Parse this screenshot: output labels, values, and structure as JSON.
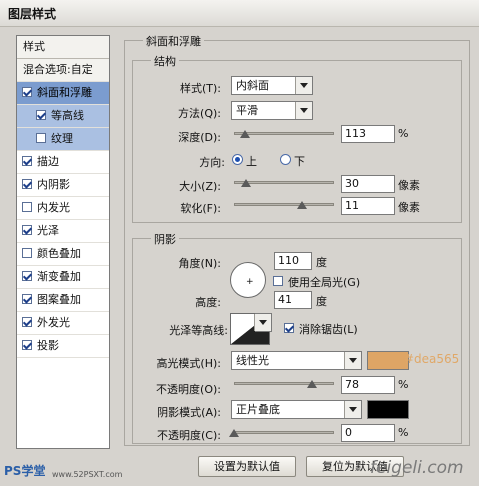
{
  "window": {
    "title": "图层样式"
  },
  "sidebar": {
    "header": "样式",
    "blending": "混合选项:自定",
    "items": [
      {
        "label": "斜面和浮雕",
        "checked": true
      },
      {
        "label": "等高线",
        "checked": true
      },
      {
        "label": "纹理",
        "checked": false
      },
      {
        "label": "描边",
        "checked": true
      },
      {
        "label": "内阴影",
        "checked": true
      },
      {
        "label": "内发光",
        "checked": false
      },
      {
        "label": "光泽",
        "checked": true
      },
      {
        "label": "颜色叠加",
        "checked": false
      },
      {
        "label": "渐变叠加",
        "checked": true
      },
      {
        "label": "图案叠加",
        "checked": true
      },
      {
        "label": "外发光",
        "checked": true
      },
      {
        "label": "投影",
        "checked": true
      }
    ]
  },
  "bevel": {
    "section_title": "斜面和浮雕",
    "structure": {
      "title": "结构",
      "style_label": "样式(T):",
      "style_value": "内斜面",
      "technique_label": "方法(Q):",
      "technique_value": "平滑",
      "depth_label": "深度(D):",
      "depth_value": "113",
      "depth_unit": "%",
      "depth_fraction": 0.11,
      "direction_label": "方向:",
      "direction_up": "上",
      "direction_down": "下",
      "size_label": "大小(Z):",
      "size_value": "30",
      "size_unit": "像素",
      "size_fraction": 0.12,
      "soften_label": "软化(F):",
      "soften_value": "11",
      "soften_unit": "像素",
      "soften_fraction": 0.68
    },
    "shading": {
      "title": "阴影",
      "angle_label": "角度(N):",
      "angle_value": "110",
      "angle_unit": "度",
      "global_light_label": "使用全局光(G)",
      "global_light_checked": false,
      "altitude_label": "高度:",
      "altitude_value": "41",
      "altitude_unit": "度",
      "gloss_label": "光泽等高线:",
      "antialias_label": "消除锯齿(L)",
      "antialias_checked": true,
      "highlight_mode_label": "高光模式(H):",
      "highlight_mode_value": "线性光",
      "highlight_color": "#dea565",
      "highlight_color_text": "#dea565",
      "highlight_opacity_label": "不透明度(O):",
      "highlight_opacity_value": "78",
      "highlight_opacity_unit": "%",
      "highlight_opacity_fraction": 0.78,
      "shadow_mode_label": "阴影模式(A):",
      "shadow_mode_value": "正片叠底",
      "shadow_color": "#000000",
      "shadow_opacity_label": "不透明度(C):",
      "shadow_opacity_value": "0",
      "shadow_opacity_unit": "%",
      "shadow_opacity_fraction": 0.0
    }
  },
  "buttons": {
    "set_default": "设置为默认值",
    "reset_default": "复位为默认值"
  },
  "watermarks": {
    "left": "PS学堂",
    "url": "www.52PSXT.com",
    "right": "feigeli.com"
  }
}
